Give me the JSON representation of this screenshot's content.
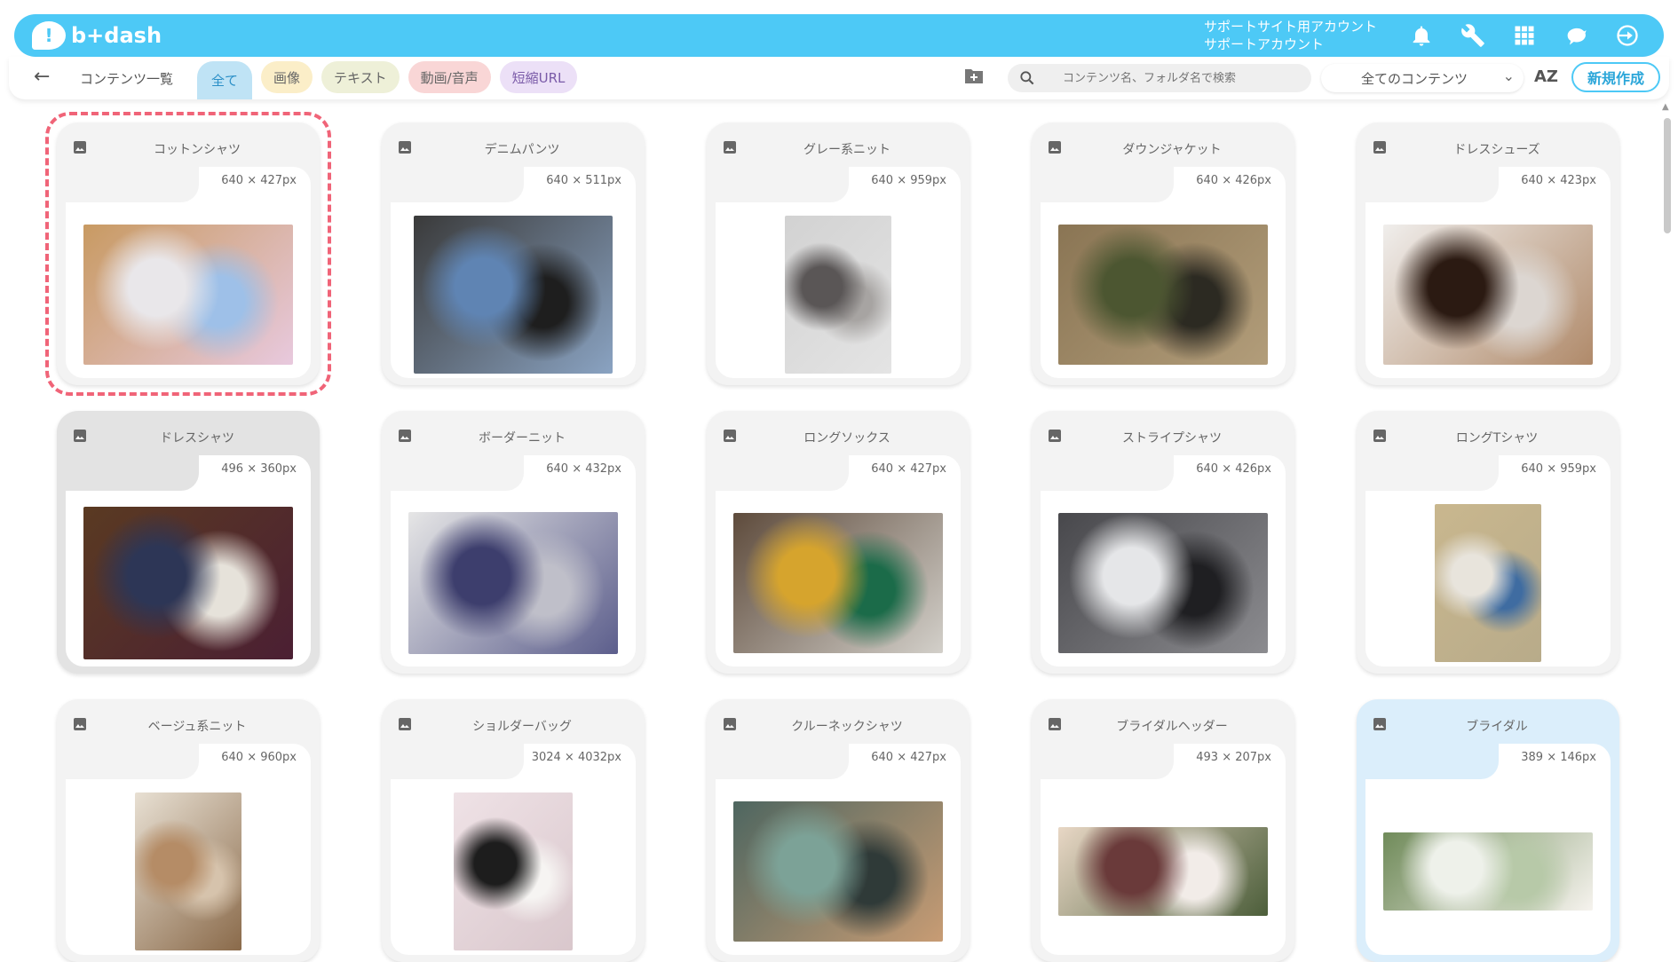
{
  "header": {
    "logo_text": "b+dash",
    "account_line1": "サポートサイト用アカウント",
    "account_line2": "サポートアカウント",
    "icons": [
      "bell-icon",
      "wrench-icon",
      "grid-icon",
      "bird-icon",
      "logout-icon"
    ]
  },
  "toolbar": {
    "breadcrumb": "コンテンツ一覧",
    "tabs": [
      "全て",
      "画像",
      "テキスト",
      "動画/音声",
      "短縮URL"
    ],
    "search_placeholder": "コンテンツ名、フォルダ名で検索",
    "select_value": "全てのコンテンツ",
    "sort_label": "AZ",
    "new_button": "新規作成"
  },
  "cards": [
    {
      "title": "コットンシャツ",
      "size": "640 × 427px",
      "colors": [
        "#c89a62",
        "#e9e7ea",
        "#9ec0e8",
        "#e8c9de"
      ]
    },
    {
      "title": "デニムパンツ",
      "size": "640 × 511px",
      "colors": [
        "#3a3a3a",
        "#5f84b3",
        "#1e1e1e",
        "#8aa3c2"
      ]
    },
    {
      "title": "グレー系ニット",
      "size": "640 × 959px",
      "colors": [
        "#d2d2d2",
        "#5a5656",
        "#a7a4a2",
        "#e4e4e4"
      ]
    },
    {
      "title": "ダウンジャケット",
      "size": "640 × 426px",
      "colors": [
        "#8a7554",
        "#4c5631",
        "#2c2a22",
        "#b29d7a"
      ]
    },
    {
      "title": "ドレスシューズ",
      "size": "640 × 423px",
      "colors": [
        "#f0eeec",
        "#2b1a12",
        "#dcd6d1",
        "#b08a6a"
      ]
    },
    {
      "title": "ドレスシャツ",
      "size": "496 × 360px",
      "colors": [
        "#5a3a22",
        "#2d3656",
        "#e6e2da",
        "#4b1f33"
      ]
    },
    {
      "title": "ボーダーニット",
      "size": "640 × 432px",
      "colors": [
        "#e6e6e6",
        "#3d3e6d",
        "#bfbfc9",
        "#5c5e8c"
      ]
    },
    {
      "title": "ロングソックス",
      "size": "640 × 427px",
      "colors": [
        "#5e4b3c",
        "#d6a42d",
        "#1b6b49",
        "#d3d0ca"
      ]
    },
    {
      "title": "ストライプシャツ",
      "size": "640 × 426px",
      "colors": [
        "#48484c",
        "#e5e6e8",
        "#1f1f22",
        "#8c8c90"
      ]
    },
    {
      "title": "ロングTシャツ",
      "size": "640 × 959px",
      "colors": [
        "#c9b78e",
        "#e8e4dc",
        "#3f6ca1",
        "#b8ab8a"
      ]
    },
    {
      "title": "ベージュ系ニット",
      "size": "640 × 960px",
      "colors": [
        "#e8e0d3",
        "#b58c66",
        "#d6c3ac",
        "#8a6a4a"
      ]
    },
    {
      "title": "ショルダーバッグ",
      "size": "3024 × 4032px",
      "colors": [
        "#efe2e6",
        "#1d1d1d",
        "#f6f4f2",
        "#d9c7cc"
      ]
    },
    {
      "title": "クルーネックシャツ",
      "size": "640 × 427px",
      "colors": [
        "#4e6660",
        "#7ca297",
        "#2f3a38",
        "#c89c74"
      ]
    },
    {
      "title": "ブライダルヘッダー",
      "size": "493 × 207px",
      "colors": [
        "#e8d7c5",
        "#6a3a3a",
        "#f2ece8",
        "#4c5e3a"
      ]
    },
    {
      "title": "ブライダル",
      "size": "389 × 146px",
      "colors": [
        "#708b5a",
        "#eef1ea",
        "#b7c9a8",
        "#f6f3ee"
      ]
    }
  ]
}
